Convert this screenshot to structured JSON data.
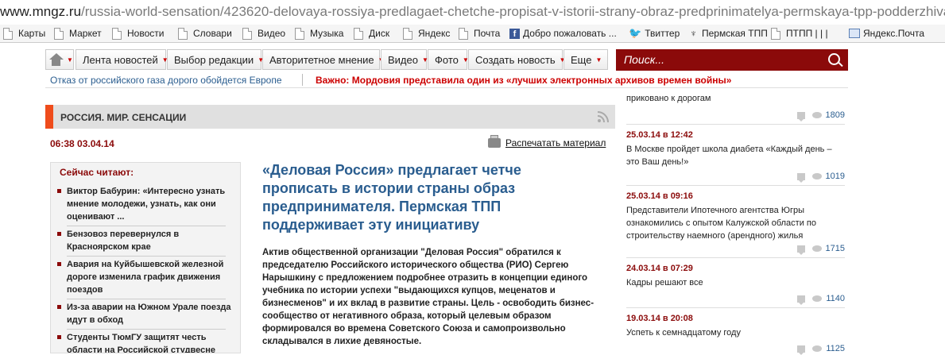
{
  "browser": {
    "url_host": "www.mngz.ru",
    "url_path": "/russia-world-sensation/423620-delovaya-rossiya-predlagaet-chetche-propisat-v-istorii-strany-obraz-predprinimatelya-permskaya-tpp-podderzhivaet-e",
    "bookmarks": [
      "Карты",
      "Маркет",
      "Новости",
      "Словари",
      "Видео",
      "Музыка",
      "Диск",
      "Яндекс",
      "Почта",
      "Добро пожаловать ...",
      "Твиттер",
      "Пермская ТПП",
      "ПТПП | | |",
      "Яндекс.Почта"
    ]
  },
  "nav": {
    "items": [
      "Лента новостей",
      "Выбор редакции",
      "Авторитетное мнение",
      "Видео",
      "Фото",
      "Создать новость",
      "Еще"
    ],
    "search_placeholder": "Поиск..."
  },
  "ticker": {
    "left": "Отказ от российского газа дорого обойдется Европе",
    "important": "Важно: Мордовия представила один из «лучших электронных архивов времен войны»"
  },
  "section": {
    "title": "РОССИЯ. МИР. СЕНСАЦИИ"
  },
  "article": {
    "datetime": "06:38 03.04.14",
    "print_label": "Распечатать материал",
    "title": "«Деловая Россия» предлагает четче прописать в истории страны образ предпринимателя. Пермская ТПП поддерживает эту инициативу",
    "lead": "Актив общественной организации \"Деловая Россия\" обратился к председателю Российского исторического общества (РИО) Сергею Нарышкину с предложением подробнее отразить в концепции единого учебника по истории успехи \"выдающихся купцов, меценатов и бизнесменов\" и их вклад в развитие страны. Цель - освободить бизнес-сообщество от негативного образа, который целевым образом формировался во времена Советского Союза и самопроизвольно складывался в лихие девяностые."
  },
  "reading_now": {
    "title": "Сейчас читают:",
    "items": [
      "Виктор Бабурин: «Интересно узнать мнение молодежи, узнать, как они оценивают ...",
      "Бензовоз перевернулся в Красноярском крае",
      "Авария на Куйбышевской железной дороге изменила график движения поездов",
      "Из-за аварии на Южном Урале поезда идут в обход",
      "Студенты ТюмГУ защитят честь области на Российской студвесне"
    ]
  },
  "right_news": [
    {
      "date": "",
      "text": "приковано к дорогам",
      "views": "1809"
    },
    {
      "date": "25.03.14 в 12:42",
      "text": "В Москве пройдет школа диабета «Каждый день – это Ваш день!»",
      "views": "1019"
    },
    {
      "date": "25.03.14 в 09:16",
      "text": "Представители Ипотечного агентства Югры ознакомились с опытом Калужской области по строительству наемного (арендного) жилья",
      "views": "1715"
    },
    {
      "date": "24.03.14 в 07:29",
      "text": "Кадры решают все",
      "views": "1140"
    },
    {
      "date": "19.03.14 в 20:08",
      "text": "Успеть к семнадцатому году",
      "views": "1125"
    }
  ],
  "colors": {
    "brand": "#8b0a0a",
    "accent": "#ef4c1c",
    "link": "#2a5d8f"
  }
}
